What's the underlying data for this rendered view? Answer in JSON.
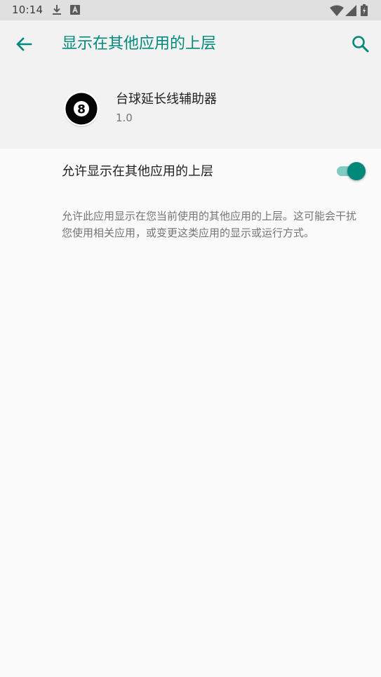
{
  "status_bar": {
    "time": "10:14"
  },
  "app_bar": {
    "title": "显示在其他应用的上层"
  },
  "app_info": {
    "name": "台球延长线辅助器",
    "version": "1.0",
    "icon_glyph": "8"
  },
  "setting": {
    "label": "允许显示在其他应用的上层",
    "enabled": true
  },
  "description": "允许此应用显示在您当前使用的其他应用的上层。这可能会干扰您使用相关应用，或变更这类应用的显示或运行方式。",
  "colors": {
    "accent": "#00897b",
    "switch_track": "#80cbc4",
    "status_bar": "#e0e0e0",
    "header": "#f2f2f2",
    "background": "#fafafa"
  }
}
